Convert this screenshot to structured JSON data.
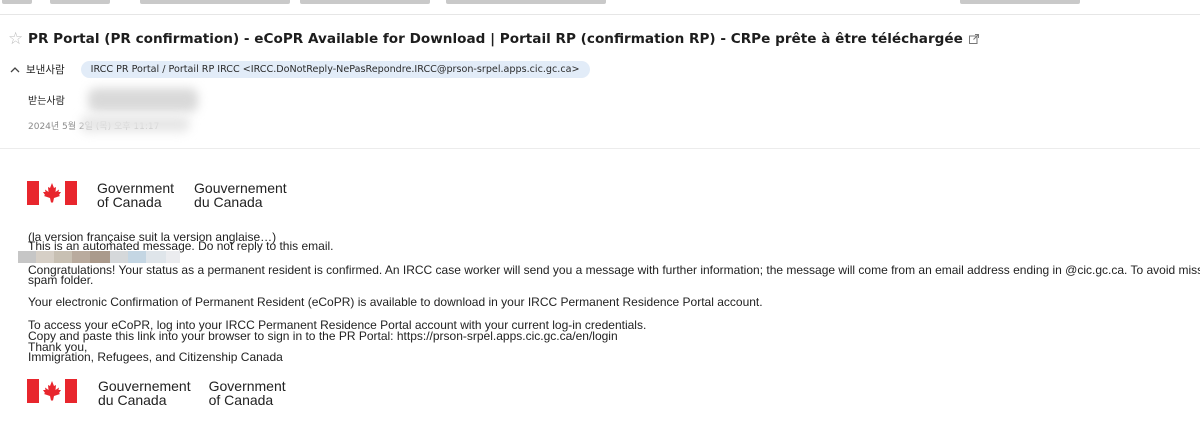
{
  "email": {
    "subject": "PR Portal (PR confirmation) - eCoPR Available for Download | Portail RP (confirmation RP) - CRPe prête à être téléchargée",
    "from_label": "보낸사람",
    "from_value": "IRCC PR Portal / Portail RP IRCC <IRCC.DoNotReply-NePasRepondre.IRCC@prson-srpel.apps.cic.gc.ca>",
    "to_label": "받는사람",
    "date": "2024년 5월 2일 (목) 오후 11:17"
  },
  "header_logo": {
    "left_line1": "Government",
    "left_line2": "of Canada",
    "right_line1": "Gouvernement",
    "right_line2": "du Canada"
  },
  "footer_logo": {
    "left_line1": "Gouvernement",
    "left_line2": "du Canada",
    "right_line1": "Government",
    "right_line2": "of Canada"
  },
  "body": {
    "french_note": "(la version française suit la version anglaise…)",
    "automated": "This is an automated message. Do not reply to this email.",
    "congrats": "Congratulations! Your status as a permanent resident is confirmed. An IRCC case worker will send you a message with further information; the message will come from an email address ending in @cic.gc.ca. To avoid missing our",
    "spam": "spam folder.",
    "ecopr": "Your electronic Confirmation of Permanent Resident (eCoPR) is available to download in your IRCC Permanent Residence Portal account.",
    "access": "To access your eCoPR, log into your IRCC Permanent Residence Portal account with your current log-in credentials.",
    "copy_link": "Copy and paste this link into your browser to sign in to the PR Portal: https://prson-srpel.apps.cic.gc.ca/en/login",
    "thanks": "Thank you,",
    "signature": "Immigration, Refugees, and Citizenship Canada"
  },
  "colors": {
    "flag_red": "#e8262d",
    "chip_bg": "#e2ecf8"
  }
}
